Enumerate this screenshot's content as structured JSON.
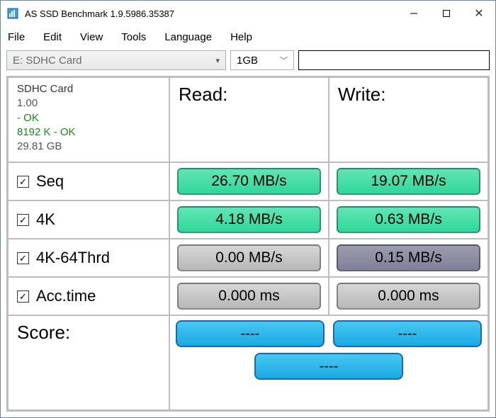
{
  "window": {
    "title": "AS SSD Benchmark 1.9.5986.35387"
  },
  "menu": {
    "file": "File",
    "edit": "Edit",
    "view": "View",
    "tools": "Tools",
    "language": "Language",
    "help": "Help"
  },
  "toolbar": {
    "drive": "E: SDHC Card",
    "size": "1GB",
    "textValue": ""
  },
  "info": {
    "name": "SDHC Card",
    "version": "1.00",
    "status1": " - OK",
    "status2": "8192 K - OK",
    "capacity": "29.81 GB"
  },
  "headers": {
    "read": "Read:",
    "write": "Write:",
    "score": "Score:"
  },
  "rows": {
    "seq": {
      "label": "Seq",
      "read": "26.70 MB/s",
      "write": "19.07 MB/s"
    },
    "k4": {
      "label": "4K",
      "read": "4.18 MB/s",
      "write": "0.63 MB/s"
    },
    "k464": {
      "label": "4K-64Thrd",
      "read": "0.00 MB/s",
      "write": "0.15 MB/s"
    },
    "acc": {
      "label": "Acc.time",
      "read": "0.000 ms",
      "write": "0.000 ms"
    }
  },
  "score": {
    "read": "----",
    "write": "----",
    "total": "----"
  },
  "icons": {
    "check": "✓"
  }
}
